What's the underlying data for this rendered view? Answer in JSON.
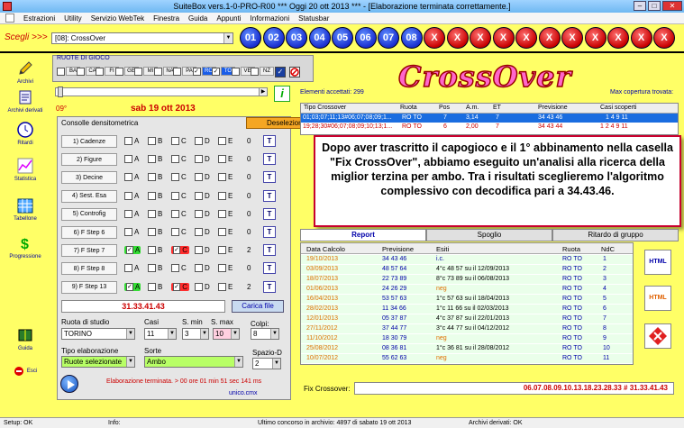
{
  "title": "SuiteBox vers.1-0-PRO-R00  ***  Oggi 20 ott 2013  ***  - [Elaborazione terminata correttamente.]",
  "menu": [
    "Estrazioni",
    "Utility",
    "Servizio WebTek",
    "Finestra",
    "Guida",
    "Appunti",
    "Informazioni",
    "Statusbar"
  ],
  "scegli_label": "Scegli >>>",
  "scegli_value": "[08]: CrossOver",
  "circles": [
    "01",
    "02",
    "03",
    "04",
    "05",
    "06",
    "07",
    "08",
    "X",
    "X",
    "X",
    "X",
    "X",
    "X",
    "X",
    "X",
    "X",
    "X",
    "X"
  ],
  "sidebar": [
    "Archivi",
    "Archivi derivati",
    "Ritardi",
    "Statistica",
    "Tabellone",
    "Progressione",
    "Guida",
    "Esci"
  ],
  "ruote_label": "RUOTE DI GIOCO",
  "ruote": [
    "BA",
    "CA",
    "FI",
    "GE",
    "MI",
    "NA",
    "PA",
    "RO",
    "TO",
    "VE",
    "NZ"
  ],
  "last_extraction_num": "09°",
  "last_extraction_date": "sab 19 ott 2013",
  "consolle_title": "Consolle densitometrica",
  "deseleziona_label": "Deseleziona Tutto",
  "filters": [
    {
      "name": "1) Cadenze",
      "count": "0"
    },
    {
      "name": "2) Figure",
      "count": "0"
    },
    {
      "name": "3) Decine",
      "count": "0"
    },
    {
      "name": "4) Sest. Esa",
      "count": "0"
    },
    {
      "name": "5) Controfig",
      "count": "0"
    },
    {
      "name": "6) F Step 6",
      "count": "0"
    },
    {
      "name": "7) F Step 7",
      "count": "2"
    },
    {
      "name": "8) F Step 8",
      "count": "0"
    },
    {
      "name": "9) F Step 13",
      "count": "2"
    }
  ],
  "opt_letters": [
    "A",
    "B",
    "C",
    "D",
    "E"
  ],
  "t_label": "T",
  "terzina": "31.33.41.43",
  "carica_label": "Carica file",
  "ruota_studio_label": "Ruota di studio",
  "ruota_studio_value": "TORINO",
  "casi_label": "Casi",
  "casi_value": "11",
  "smin_label": "S. min",
  "smin_value": "3",
  "smax_label": "S. max",
  "smax_value": "10",
  "colpi_label": "Colpi:",
  "colpi_value": "8",
  "tipo_label": "Tipo elaborazione",
  "tipo_value": "Ruote selezionate",
  "sorte_label": "Sorte",
  "sorte_value": "Ambo",
  "spazio_label": "Spazio-D",
  "spazio_value": "2",
  "elab_text": "Elaborazione terminata. > 00 ore 01 min 51 sec 141 ms",
  "unico_text": "unico.cmx",
  "logo": "CrossOver",
  "elementi": "Elementi accettati: 299",
  "max_copertura": "Max copertura trovata:",
  "grid1_headers": [
    "Tipo Crossover",
    "Ruota",
    "Pos",
    "A.m.",
    "ET",
    "Previsione",
    "Casi scoperti"
  ],
  "grid1_rows": [
    [
      "01;03;07;11;13#06;07;08;09;1...",
      "RO TO",
      "7",
      "3,14",
      "7",
      "34 43 46",
      "1 4 9 11"
    ],
    [
      "19;28;30#06;07;08;09;10;13;1...",
      "RO TO",
      "6",
      "2,00",
      "7",
      "34 43 44",
      "1 2 4 9 11"
    ]
  ],
  "overlay_text": "Dopo aver trascritto il capogioco  e il 1° abbinamento nella casella \"Fix CrossOver\", abbiamo eseguito un'analisi  alla ricerca della miglior terzina per ambo. Tra i risultati sceglieremo l'algoritmo complessivo con decodifica pari a 34.43.46.",
  "tabs": [
    "Report",
    "Spoglio",
    "Ritardo di gruppo"
  ],
  "grid2_headers": [
    "Data Calcolo",
    "Previsione",
    "Esiti",
    "Ruota",
    "NdC"
  ],
  "grid2_rows": [
    [
      "19/10/2013",
      "34 43 46",
      "i.c.",
      "RO TO",
      "1"
    ],
    [
      "03/09/2013",
      "48 57 64",
      "4°c 48 57 su il 12/09/2013",
      "RO TO",
      "2"
    ],
    [
      "18/07/2013",
      "22 73 89",
      "8°c 73 89 su il 06/08/2013",
      "RO TO",
      "3"
    ],
    [
      "01/06/2013",
      "24 26 29",
      "neg",
      "RO TO",
      "4"
    ],
    [
      "16/04/2013",
      "53 57 63",
      "1°c 57 63 su il 18/04/2013",
      "RO TO",
      "5"
    ],
    [
      "28/02/2013",
      "11 34 66",
      "1°c 11 66 su il 02/03/2013",
      "RO TO",
      "6"
    ],
    [
      "12/01/2013",
      "05 37 87",
      "4°c 37 87 su il 22/01/2013",
      "RO TO",
      "7"
    ],
    [
      "27/11/2012",
      "37 44 77",
      "3°c 44 77 su il 04/12/2012",
      "RO TO",
      "8"
    ],
    [
      "11/10/2012",
      "18 30 79",
      "neg",
      "RO TO",
      "9"
    ],
    [
      "25/08/2012",
      "08 36 81",
      "1°c 36 81 su il 28/08/2012",
      "RO TO",
      "10"
    ],
    [
      "10/07/2012",
      "55 62 63",
      "neg",
      "RO TO",
      "11"
    ]
  ],
  "right_buttons": [
    "HTML",
    "HTML",
    ""
  ],
  "fix_label": "Fix Crossover:",
  "fix_value": "06.07.08.09.10.13.18.23.28.33 # 31.33.41.43",
  "status": [
    "Setup: OK",
    "Info:",
    "Ultimo concorso in archivio: 4897 di sabato 19 ott 2013",
    "Archivi derivati: OK"
  ]
}
